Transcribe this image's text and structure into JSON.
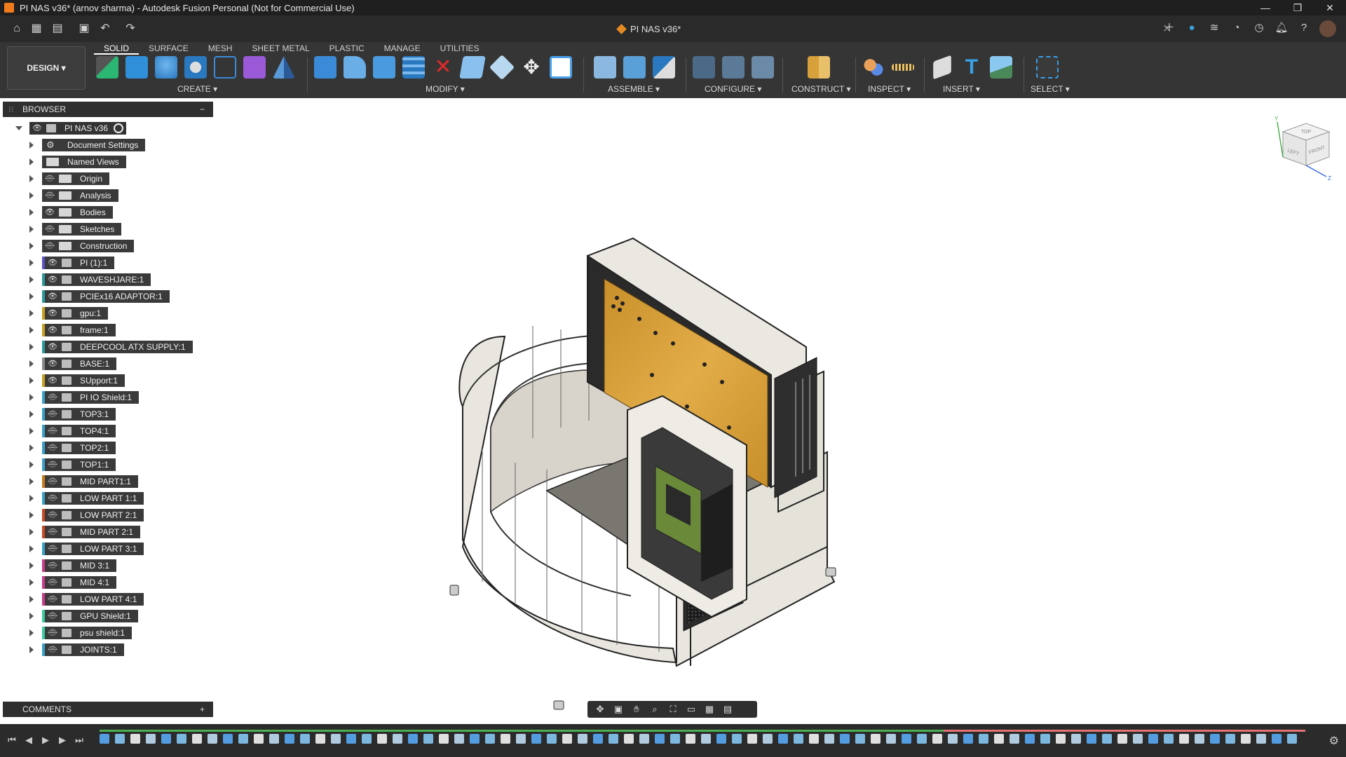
{
  "window": {
    "title": "PI NAS v36* (arnov sharma) - Autodesk Fusion Personal (Not for Commercial Use)",
    "controls": [
      "—",
      "❐",
      "✕"
    ]
  },
  "document_tab": {
    "title": "PI NAS v36*"
  },
  "workspace": {
    "label": "DESIGN ▾"
  },
  "ribbon": {
    "tabs": [
      "SOLID",
      "SURFACE",
      "MESH",
      "SHEET METAL",
      "PLASTIC",
      "MANAGE",
      "UTILITIES"
    ],
    "active_tab": "SOLID",
    "groups": {
      "create": "CREATE ▾",
      "modify": "MODIFY ▾",
      "assemble": "ASSEMBLE ▾",
      "configure": "CONFIGURE ▾",
      "construct": "CONSTRUCT ▾",
      "inspect": "INSPECT ▾",
      "insert": "INSERT ▾",
      "select": "SELECT ▾"
    }
  },
  "browser": {
    "header": "BROWSER",
    "root": "PI NAS v36",
    "items": [
      {
        "label": "Document Settings",
        "icon": "gear-icon",
        "visible": null,
        "color": ""
      },
      {
        "label": "Named Views",
        "icon": "folder-icon",
        "visible": null,
        "color": ""
      },
      {
        "label": "Origin",
        "icon": "folder-icon",
        "visible": false,
        "color": ""
      },
      {
        "label": "Analysis",
        "icon": "folder-icon",
        "visible": false,
        "color": ""
      },
      {
        "label": "Bodies",
        "icon": "folder-icon",
        "visible": true,
        "color": ""
      },
      {
        "label": "Sketches",
        "icon": "folder-icon",
        "visible": false,
        "color": ""
      },
      {
        "label": "Construction",
        "icon": "folder-icon",
        "visible": false,
        "color": ""
      },
      {
        "label": "PI (1):1",
        "icon": "component-icon",
        "visible": true,
        "color": "#5a4fc8"
      },
      {
        "label": "WAVESHJARE:1",
        "icon": "component-icon",
        "visible": true,
        "color": "#2a9a9a"
      },
      {
        "label": "PCIEx16 ADAPTOR:1",
        "icon": "component-icon",
        "visible": true,
        "color": "#2a9a9a"
      },
      {
        "label": "gpu:1",
        "icon": "component-icon",
        "visible": true,
        "color": "#c8a020"
      },
      {
        "label": "frame:1",
        "icon": "component-icon",
        "visible": true,
        "color": "#c8a020"
      },
      {
        "label": "DEEPCOOL ATX SUPPLY:1",
        "icon": "component-icon",
        "visible": true,
        "color": "#2a9a9a"
      },
      {
        "label": "BASE:1",
        "icon": "component-icon",
        "visible": true,
        "color": "#8a8a8a"
      },
      {
        "label": "SUpport:1",
        "icon": "component-icon",
        "visible": true,
        "color": "#c8a020"
      },
      {
        "label": "PI IO Shield:1",
        "icon": "component-icon",
        "visible": false,
        "color": "#3aa0c8"
      },
      {
        "label": "TOP3:1",
        "icon": "component-icon",
        "visible": false,
        "color": "#3aa0c8"
      },
      {
        "label": "TOP4:1",
        "icon": "component-icon",
        "visible": false,
        "color": "#3aa0c8"
      },
      {
        "label": "TOP2:1",
        "icon": "component-icon",
        "visible": false,
        "color": "#3aa0c8"
      },
      {
        "label": "TOP1:1",
        "icon": "component-icon",
        "visible": false,
        "color": "#3aa0c8"
      },
      {
        "label": "MID PART1:1",
        "icon": "component-icon",
        "visible": false,
        "color": "#c87a20"
      },
      {
        "label": "LOW PART 1:1",
        "icon": "component-icon",
        "visible": false,
        "color": "#3aa0c8"
      },
      {
        "label": "LOW PART 2:1",
        "icon": "component-icon",
        "visible": false,
        "color": "#c84a20"
      },
      {
        "label": "MID PART 2:1",
        "icon": "component-icon",
        "visible": false,
        "color": "#c84a20"
      },
      {
        "label": "LOW PART 3:1",
        "icon": "component-icon",
        "visible": false,
        "color": "#3aa0c8"
      },
      {
        "label": "MID 3:1",
        "icon": "component-icon",
        "visible": false,
        "color": "#c83a8a"
      },
      {
        "label": "MID 4:1",
        "icon": "component-icon",
        "visible": false,
        "color": "#c83a8a"
      },
      {
        "label": "LOW PART 4:1",
        "icon": "component-icon",
        "visible": false,
        "color": "#c83a8a"
      },
      {
        "label": "GPU Shield:1",
        "icon": "component-icon",
        "visible": false,
        "color": "#3ac8a0"
      },
      {
        "label": "psu shield:1",
        "icon": "component-icon",
        "visible": false,
        "color": "#3ac8a0"
      },
      {
        "label": "JOINTS:1",
        "icon": "component-icon",
        "visible": false,
        "color": "#3aa0c8"
      }
    ]
  },
  "comments": {
    "header": "COMMENTS",
    "add": "+"
  },
  "viewcube": {
    "top": "TOP",
    "left": "LEFT",
    "front": "FRONT",
    "axis_y": "Y",
    "axis_z": "Z"
  },
  "colors": {
    "accent": "#0696d7",
    "ribbon_bg": "#353535",
    "panel_bg": "#2f2f2f",
    "pcb": "#d7a23a"
  }
}
